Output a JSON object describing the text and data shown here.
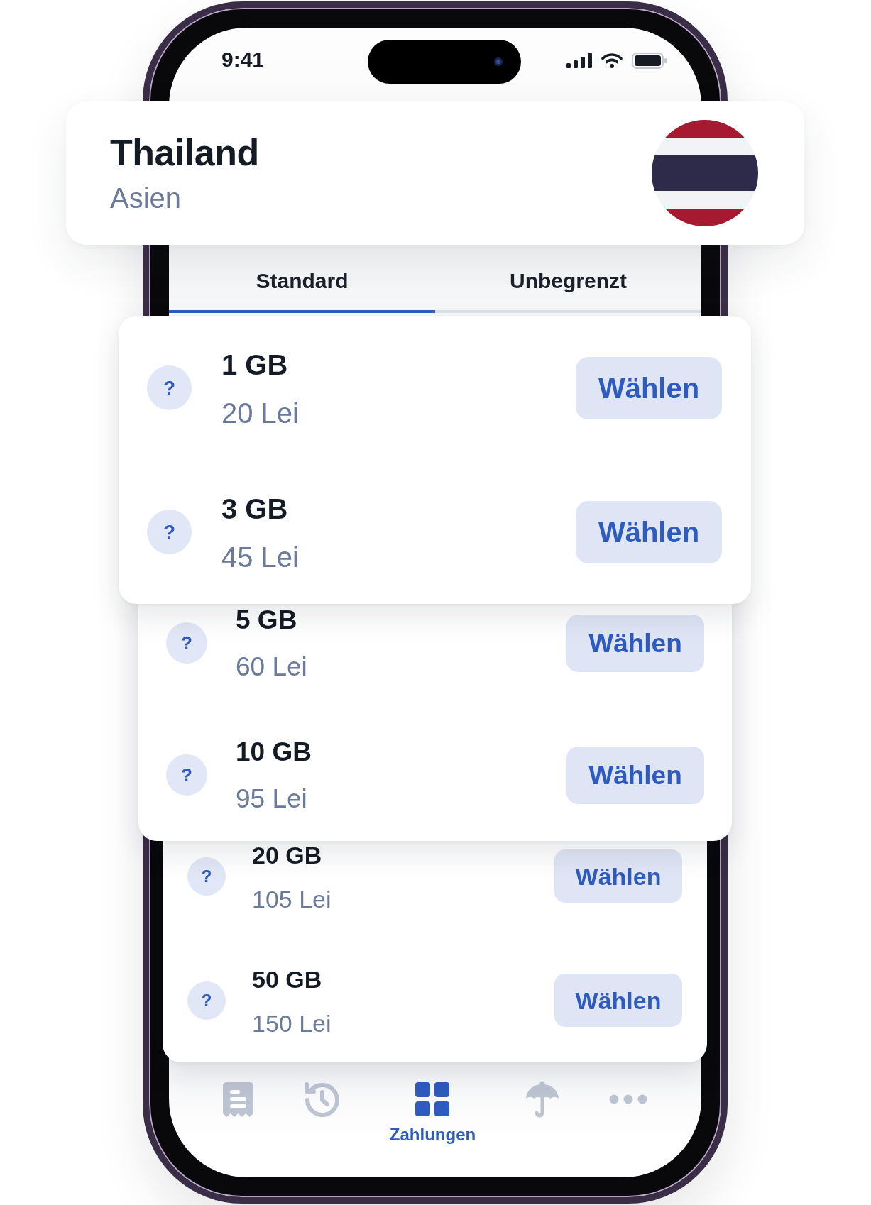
{
  "status_bar": {
    "time": "9:41"
  },
  "header": {
    "title": "Thailand",
    "subtitle": "Asien"
  },
  "tabs": [
    {
      "label": "Standard",
      "selected": true
    },
    {
      "label": "Unbegrenzt",
      "selected": false
    }
  ],
  "plan_cards": [
    {
      "plans": [
        {
          "info": "?",
          "data": "1 GB",
          "price": "20 Lei",
          "action": "Wählen"
        },
        {
          "info": "?",
          "data": "3 GB",
          "price": "45 Lei",
          "action": "Wählen"
        }
      ]
    },
    {
      "plans": [
        {
          "info": "?",
          "data": "5 GB",
          "price": "60 Lei",
          "action": "Wählen"
        },
        {
          "info": "?",
          "data": "10 GB",
          "price": "95 Lei",
          "action": "Wählen"
        }
      ]
    },
    {
      "plans": [
        {
          "info": "?",
          "data": "20 GB",
          "price": "105 Lei",
          "action": "Wählen"
        },
        {
          "info": "?",
          "data": "50 GB",
          "price": "150 Lei",
          "action": "Wählen"
        }
      ]
    }
  ],
  "bottom_nav": [
    {
      "kind": "receipt",
      "selected": false
    },
    {
      "kind": "history",
      "selected": false
    },
    {
      "kind": "grid",
      "label": "Zahlungen",
      "selected": true
    },
    {
      "kind": "umbrella",
      "selected": false
    },
    {
      "kind": "more",
      "selected": false
    }
  ]
}
